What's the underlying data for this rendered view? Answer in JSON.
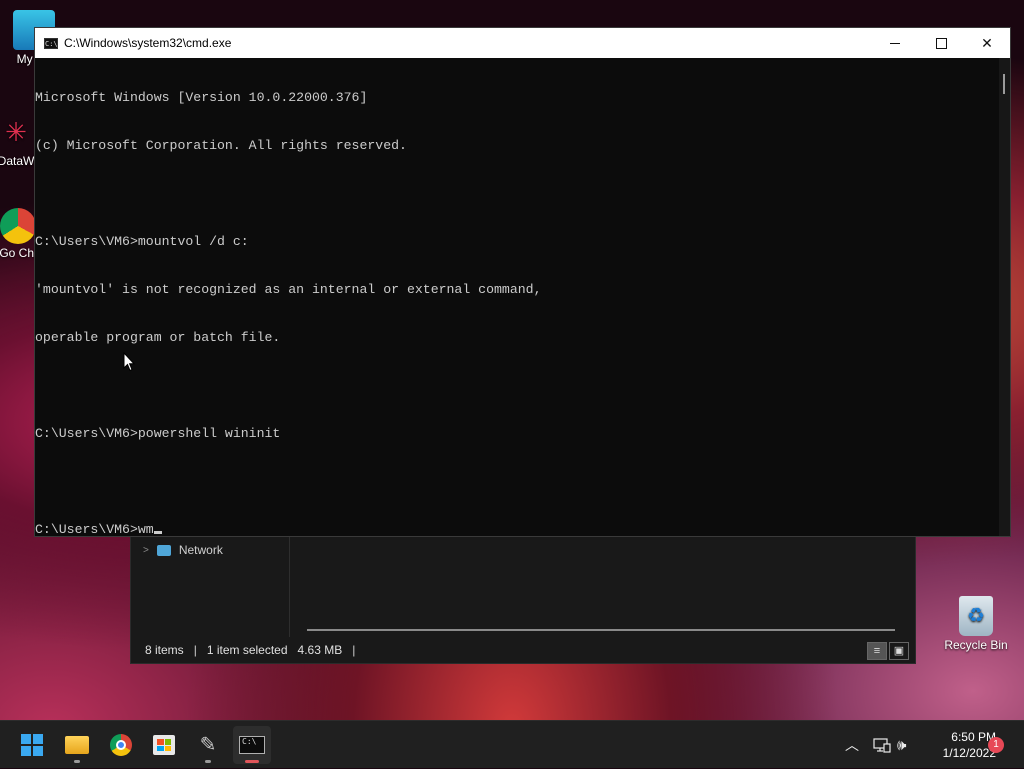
{
  "desktop": {
    "icons": [
      {
        "label": "My Co"
      },
      {
        "label": "DataW"
      },
      {
        "label": "Go Chi"
      },
      {
        "label": "Recycle Bin"
      }
    ]
  },
  "explorer": {
    "nav_item": "Network",
    "status": {
      "items": "8 items",
      "selected": "1 item selected",
      "size": "4.63 MB"
    }
  },
  "cmd": {
    "title": "C:\\Windows\\system32\\cmd.exe",
    "lines": [
      "Microsoft Windows [Version 10.0.22000.376]",
      "(c) Microsoft Corporation. All rights reserved.",
      "",
      "C:\\Users\\VM6>mountvol /d c:",
      "'mountvol' is not recognized as an internal or external command,",
      "operable program or batch file.",
      "",
      "C:\\Users\\VM6>powershell wininit",
      "",
      "C:\\Users\\VM6>wm"
    ]
  },
  "taskbar": {
    "clock_time": "6:50 PM",
    "clock_date": "1/12/2022",
    "notification_count": "1"
  }
}
